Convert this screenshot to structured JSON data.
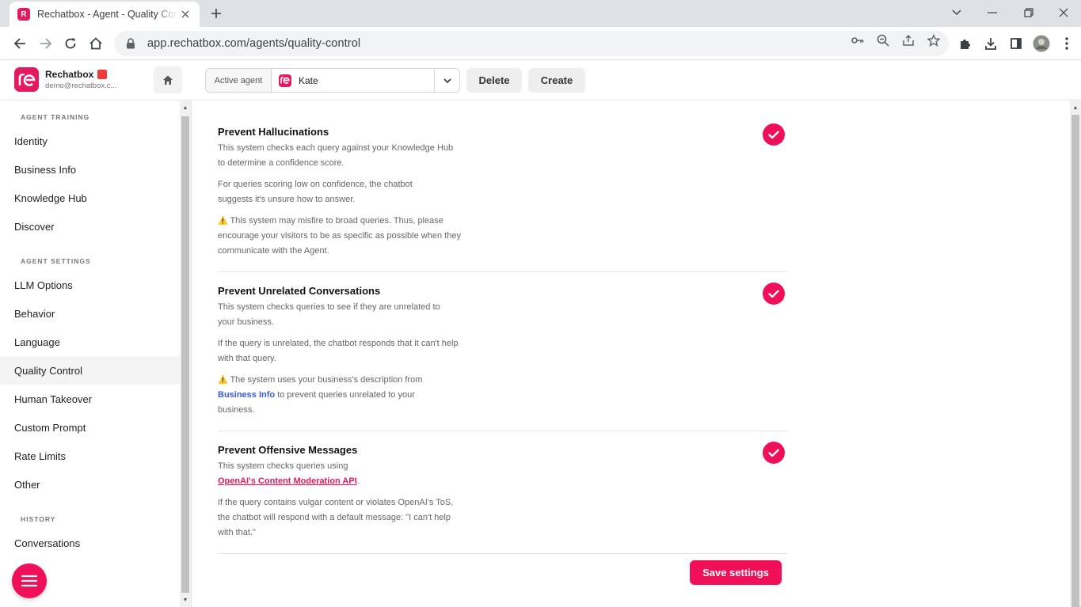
{
  "browser": {
    "tab_title": "Rechatbox - Agent - Quality Control",
    "url": "app.rechatbox.com/agents/quality-control"
  },
  "brand": {
    "name": "Rechatbox",
    "email": "demo@rechatbox.c..."
  },
  "header": {
    "active_agent_label": "Active agent",
    "agent_name": "Kate",
    "delete_label": "Delete",
    "create_label": "Create"
  },
  "sidebar": {
    "sections": [
      {
        "title": "AGENT TRAINING",
        "items": [
          "Identity",
          "Business Info",
          "Knowledge Hub",
          "Discover"
        ]
      },
      {
        "title": "AGENT SETTINGS",
        "items": [
          "LLM Options",
          "Behavior",
          "Language",
          "Quality Control",
          "Human Takeover",
          "Custom Prompt",
          "Rate Limits",
          "Other"
        ]
      },
      {
        "title": "HISTORY",
        "items": [
          "Conversations"
        ]
      }
    ],
    "active_item": "Quality Control"
  },
  "settings": [
    {
      "title": "Prevent Hallucinations",
      "p1": "This system checks each query against your Knowledge Hub to determine a confidence score.",
      "p2": "For queries scoring low on confidence, the chatbot suggests it's unsure how to answer.",
      "p3": "This system may misfire to broad queries. Thus, please encourage your visitors to be as specific as possible when they communicate with the Agent.",
      "checked": true
    },
    {
      "title": "Prevent Unrelated Conversations",
      "p1": "This system checks queries to see if they are unrelated to your business.",
      "p2": "If the query is unrelated, the chatbot responds that it can't help with that query.",
      "p3_pre": "The system uses your business's description from",
      "p3_link": "Business Info",
      "p3_post": "to prevent queries unrelated to your business.",
      "checked": true
    },
    {
      "title": "Prevent Offensive Messages",
      "p1": "This system checks queries using",
      "p1_link": "OpenAI's Content Moderation API",
      "p1_post": ".",
      "p2": "If the query contains vulgar content or violates OpenAI's ToS, the chatbot will respond with a default message: \"I can't help with that.\"",
      "checked": true
    }
  ],
  "save_label": "Save settings",
  "colors": {
    "accent": "#f0105a",
    "link": "#3b5bd9"
  }
}
